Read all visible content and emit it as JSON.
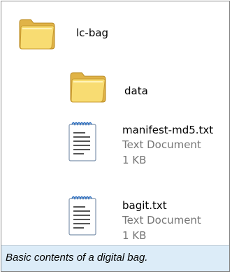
{
  "items": [
    {
      "name": "lc-bag",
      "icon": "folder-icon"
    },
    {
      "name": "data",
      "icon": "folder-icon"
    },
    {
      "name": "manifest-md5.txt",
      "type": "Text Document",
      "size": "1 KB",
      "icon": "text-document-icon"
    },
    {
      "name": "bagit.txt",
      "type": "Text Document",
      "size": "1 KB",
      "icon": "text-document-icon"
    }
  ],
  "caption": "Basic contents of a digital bag.",
  "colors": {
    "folder": "#f6d565",
    "folder_dark": "#d8a93a",
    "caption_bg": "#dcecf8"
  }
}
